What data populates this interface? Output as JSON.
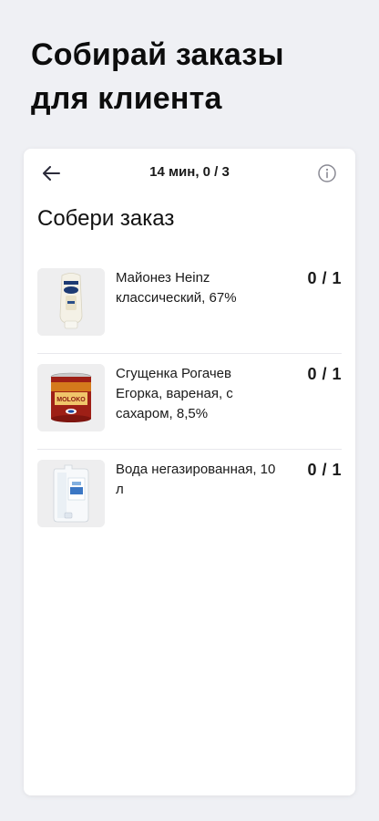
{
  "hero": {
    "line1": "Собирай заказы",
    "line2": "для клиента"
  },
  "header": {
    "back_icon": "arrow-left-icon",
    "timer_text": "14 мин, 0 / 3",
    "info_icon": "info-icon"
  },
  "order": {
    "title": "Собери заказ",
    "items": [
      {
        "name": "Майонез Heinz классический, 67%",
        "count": "0 / 1",
        "image": "mayonnaise-bottle"
      },
      {
        "name": "Сгущенка Рогачев Егорка, вареная, с сахаром, 8,5%",
        "count": "0 / 1",
        "image": "condensed-milk-can"
      },
      {
        "name": "Вода негазированная, 10 л",
        "count": "0 / 1",
        "image": "water-canister"
      }
    ]
  },
  "colors": {
    "background": "#eff0f4",
    "card": "#ffffff",
    "text": "#111111",
    "thumb_bg": "#eeeeef",
    "divider": "#e8e8ec"
  }
}
